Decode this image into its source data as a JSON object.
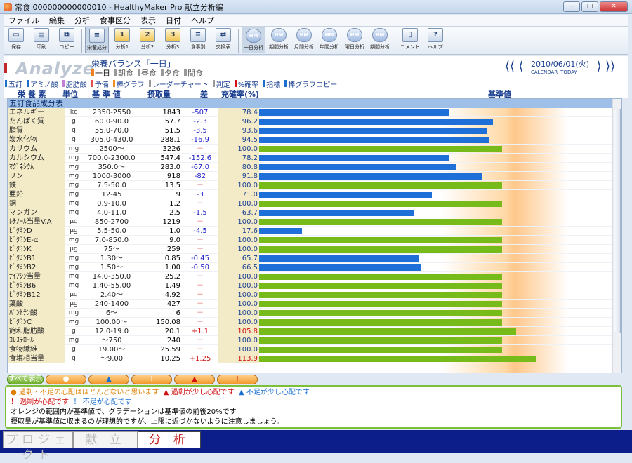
{
  "window": {
    "title": "常食 000000000000010 - HealthyMaker Pro 献立分析編"
  },
  "menu": [
    "ファイル",
    "編集",
    "分析",
    "食事区分",
    "表示",
    "日付",
    "ヘルプ"
  ],
  "toolbar": [
    {
      "label": "保存",
      "icon": "save-icon",
      "glyph": "▭",
      "type": "plain"
    },
    {
      "label": "印刷",
      "icon": "print-icon",
      "glyph": "▤",
      "type": "plain"
    },
    {
      "label": "コピー",
      "icon": "copy-icon",
      "glyph": "⧉",
      "type": "plain"
    },
    {
      "label": "栄養成分",
      "icon": "nutrition-icon",
      "glyph": "≡",
      "type": "plain",
      "selected": true
    },
    {
      "label": "分析1",
      "icon": "analysis-1-icon",
      "glyph": "1",
      "type": "num"
    },
    {
      "label": "分析2",
      "icon": "analysis-2-icon",
      "glyph": "2",
      "type": "num"
    },
    {
      "label": "分析3",
      "icon": "analysis-3-icon",
      "glyph": "3",
      "type": "num"
    },
    {
      "label": "食事別",
      "icon": "per-meal-icon",
      "glyph": "≡",
      "type": "plain"
    },
    {
      "label": "交換表",
      "icon": "exchange-table-icon",
      "glyph": "⇄",
      "type": "plain"
    },
    {
      "label": "一日分析",
      "icon": "daily-analysis-icon",
      "glyph": "HM",
      "type": "cloud",
      "selected": true
    },
    {
      "label": "期間分析",
      "icon": "period-analysis-icon",
      "glyph": "HM",
      "type": "cloud"
    },
    {
      "label": "月間分析",
      "icon": "monthly-analysis-icon",
      "glyph": "HM",
      "type": "cloud"
    },
    {
      "label": "年間分析",
      "icon": "yearly-analysis-icon",
      "glyph": "HM",
      "type": "cloud"
    },
    {
      "label": "曜日分析",
      "icon": "weekday-analysis-icon",
      "glyph": "HM",
      "type": "cloud"
    },
    {
      "label": "期間分析",
      "icon": "range-analysis-icon",
      "glyph": "HM",
      "type": "cloud"
    },
    {
      "label": "コメント",
      "icon": "comment-icon",
      "glyph": "▯",
      "type": "plain"
    },
    {
      "label": "ヘルプ",
      "icon": "help-icon",
      "glyph": "?",
      "type": "plain"
    }
  ],
  "header": {
    "analyze": "Analyze",
    "balance": "栄養バランス「一日」",
    "meals": [
      {
        "label": "一日",
        "active": true
      },
      {
        "label": "朝食"
      },
      {
        "label": "昼食"
      },
      {
        "label": "夕食"
      },
      {
        "label": "間食"
      }
    ],
    "date": "2010/06/01(火)",
    "calendar": "CALENDAR",
    "today": "TODAY"
  },
  "tabs": [
    {
      "label": "五訂",
      "color": "#1a70d0"
    },
    {
      "label": "アミノ酸",
      "color": "#1a70d0"
    },
    {
      "label": "脂肪酸",
      "color": "#c27ed0"
    },
    {
      "label": "予備",
      "color": "#e05050"
    },
    {
      "label": "棒グラフ",
      "color": "#f09020"
    },
    {
      "label": "レーダーチャート",
      "color": "#999999"
    },
    {
      "label": "判定",
      "color": "#999999"
    },
    {
      "label": "%確率",
      "color": "#d01010"
    },
    {
      "label": "指標",
      "color": "#1a70d0"
    },
    {
      "label": "棒グラフコピー",
      "color": "#1a70d0"
    }
  ],
  "columns": {
    "nutrient": "栄 養 素",
    "unit": "単位",
    "standard": "基 準 値",
    "intake": "摂取量",
    "diff": "差",
    "rate": "充確率(%)",
    "ref": "基準値"
  },
  "section": "五訂食品成分表",
  "rows": [
    {
      "name": "エネルギー",
      "unit": "kc",
      "std": "2350-2550",
      "intake": "1843",
      "diff": "-507",
      "rate": "78.4",
      "pct": 78.4
    },
    {
      "name": "たんぱく質",
      "unit": "g",
      "std": "60.0-90.0",
      "intake": "57.7",
      "diff": "-2.3",
      "rate": "96.2",
      "pct": 96.2
    },
    {
      "name": "脂質",
      "unit": "g",
      "std": "55.0-70.0",
      "intake": "51.5",
      "diff": "-3.5",
      "rate": "93.6",
      "pct": 93.6
    },
    {
      "name": "炭水化物",
      "unit": "g",
      "std": "305.0-430.0",
      "intake": "288.1",
      "diff": "-16.9",
      "rate": "94.5",
      "pct": 94.5
    },
    {
      "name": "カリウム",
      "unit": "mg",
      "std": "2500～",
      "intake": "3226",
      "diff": "－",
      "rate": "100.0",
      "pct": 100
    },
    {
      "name": "カルシウム",
      "unit": "mg",
      "std": "700.0-2300.0",
      "intake": "547.4",
      "diff": "-152.6",
      "rate": "78.2",
      "pct": 78.2
    },
    {
      "name": "ﾏｸﾞﾈｼｳﾑ",
      "unit": "mg",
      "std": "350.0～",
      "intake": "283.0",
      "diff": "-67.0",
      "rate": "80.8",
      "pct": 80.8
    },
    {
      "name": "リン",
      "unit": "mg",
      "std": "1000-3000",
      "intake": "918",
      "diff": "-82",
      "rate": "91.8",
      "pct": 91.8
    },
    {
      "name": "鉄",
      "unit": "mg",
      "std": "7.5-50.0",
      "intake": "13.5",
      "diff": "－",
      "rate": "100.0",
      "pct": 100
    },
    {
      "name": "亜鉛",
      "unit": "mg",
      "std": "12-45",
      "intake": "9",
      "diff": "-3",
      "rate": "71.0",
      "pct": 71.0
    },
    {
      "name": "銅",
      "unit": "mg",
      "std": "0.9-10.0",
      "intake": "1.2",
      "diff": "－",
      "rate": "100.0",
      "pct": 100
    },
    {
      "name": "マンガン",
      "unit": "mg",
      "std": "4.0-11.0",
      "intake": "2.5",
      "diff": "-1.5",
      "rate": "63.7",
      "pct": 63.7
    },
    {
      "name": "ﾚﾁﾉｰﾙ当量V.A",
      "unit": "μg",
      "std": "850-2700",
      "intake": "1219",
      "diff": "－",
      "rate": "100.0",
      "pct": 100
    },
    {
      "name": "ﾋﾞﾀﾐﾝD",
      "unit": "μg",
      "std": "5.5-50.0",
      "intake": "1.0",
      "diff": "-4.5",
      "rate": "17.6",
      "pct": 17.6
    },
    {
      "name": "ﾋﾞﾀﾐﾝE-α",
      "unit": "mg",
      "std": "7.0-850.0",
      "intake": "9.0",
      "diff": "－",
      "rate": "100.0",
      "pct": 100
    },
    {
      "name": "ﾋﾞﾀﾐﾝK",
      "unit": "μg",
      "std": "75～",
      "intake": "259",
      "diff": "－",
      "rate": "100.0",
      "pct": 100
    },
    {
      "name": "ﾋﾞﾀﾐﾝB1",
      "unit": "mg",
      "std": "1.30～",
      "intake": "0.85",
      "diff": "-0.45",
      "rate": "65.7",
      "pct": 65.7
    },
    {
      "name": "ﾋﾞﾀﾐﾝB2",
      "unit": "mg",
      "std": "1.50～",
      "intake": "1.00",
      "diff": "-0.50",
      "rate": "66.5",
      "pct": 66.5
    },
    {
      "name": "ﾅｲｱｼﾝ当量",
      "unit": "mg",
      "std": "14.0-350.0",
      "intake": "25.2",
      "diff": "－",
      "rate": "100.0",
      "pct": 100
    },
    {
      "name": "ﾋﾞﾀﾐﾝB6",
      "unit": "mg",
      "std": "1.40-55.00",
      "intake": "1.49",
      "diff": "－",
      "rate": "100.0",
      "pct": 100
    },
    {
      "name": "ﾋﾞﾀﾐﾝB12",
      "unit": "μg",
      "std": "2.40～",
      "intake": "4.92",
      "diff": "－",
      "rate": "100.0",
      "pct": 100
    },
    {
      "name": "葉酸",
      "unit": "μg",
      "std": "240-1400",
      "intake": "427",
      "diff": "－",
      "rate": "100.0",
      "pct": 100
    },
    {
      "name": "ﾊﾟﾝﾄﾃﾝ酸",
      "unit": "mg",
      "std": "6～",
      "intake": "6",
      "diff": "－",
      "rate": "100.0",
      "pct": 100
    },
    {
      "name": "ﾋﾞﾀﾐﾝC",
      "unit": "mg",
      "std": "100.00～",
      "intake": "150.08",
      "diff": "－",
      "rate": "100.0",
      "pct": 100
    },
    {
      "name": "飽和脂肪酸",
      "unit": "g",
      "std": "12.0-19.0",
      "intake": "20.1",
      "diff": "+1.1",
      "rate": "105.8",
      "pct": 105.8
    },
    {
      "name": "ｺﾚｽﾃﾛｰﾙ",
      "unit": "mg",
      "std": "～750",
      "intake": "240",
      "diff": "－",
      "rate": "100.0",
      "pct": 100
    },
    {
      "name": "食物繊維",
      "unit": "g",
      "std": "19.00～",
      "intake": "25.59",
      "diff": "－",
      "rate": "100.0",
      "pct": 100
    },
    {
      "name": "食塩相当量",
      "unit": "g",
      "std": "～9.00",
      "intake": "10.25",
      "diff": "+1.25",
      "rate": "113.9",
      "pct": 113.9
    }
  ],
  "filters": {
    "all": "すべて表示",
    "items": [
      "●",
      "▲",
      "!",
      "▲",
      "!"
    ]
  },
  "legend": {
    "l1a": "● 過剰・不足の心配はほとんどないと思います",
    "l1b": "▲ 過剰が少し心配です",
    "l1c": "▲ 不足が少し心配です",
    "l2a": "！ 過剰が心配です",
    "l2b": "！ 不足が心配です",
    "l3": "オレンジの範囲内が基準値で、グラデーションは基準値の前後20%です",
    "l4": "摂取量が基準値に収まるのが理想的ですが、上限に近づかないように注意しましょう。"
  },
  "bottom_tabs": [
    {
      "label": "プロジェクト"
    },
    {
      "label": "献 立"
    },
    {
      "label": "分 析",
      "active": true
    }
  ]
}
